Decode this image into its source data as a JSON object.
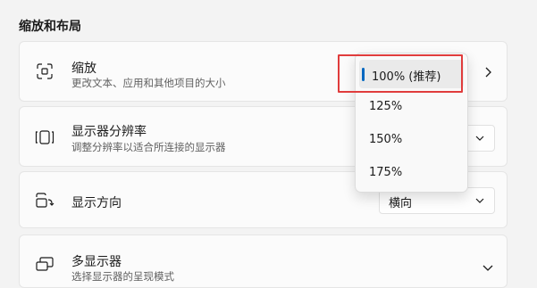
{
  "section": {
    "title": "缩放和布局"
  },
  "scale": {
    "title": "缩放",
    "subtitle": "更改文本、应用和其他项目的大小",
    "icon": "scale-icon"
  },
  "resolution": {
    "title": "显示器分辨率",
    "subtitle": "调整分辨率以适合所连接的显示器",
    "icon": "resolution-icon"
  },
  "orientation": {
    "title": "显示方向",
    "value": "横向",
    "icon": "orientation-icon"
  },
  "multi_display": {
    "title": "多显示器",
    "subtitle": "选择显示器的呈现模式",
    "icon": "multi-display-icon"
  },
  "dropdown": {
    "options": [
      "100% (推荐)",
      "125%",
      "150%",
      "175%"
    ],
    "selected_index": 0
  },
  "colors": {
    "accent": "#0067c0",
    "highlight": "#e03c3c"
  }
}
